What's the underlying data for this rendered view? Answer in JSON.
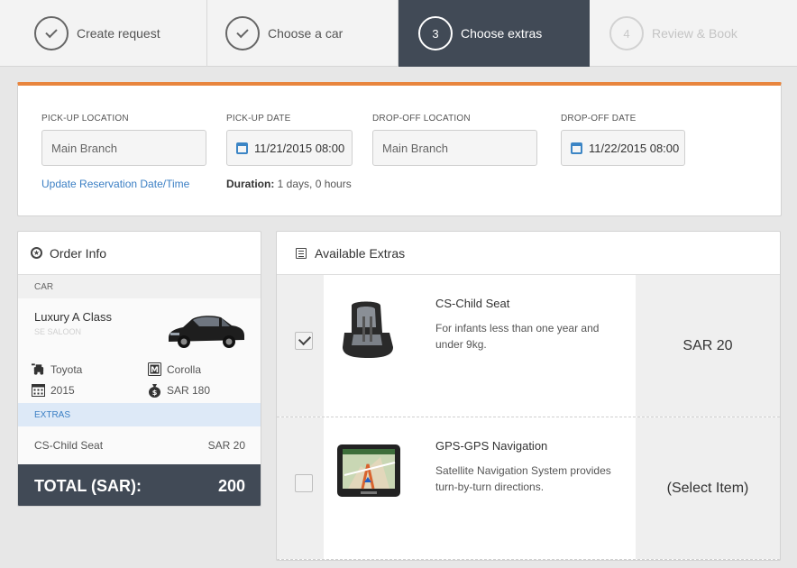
{
  "stepper": {
    "steps": [
      {
        "label": "Create request",
        "number": "",
        "state": "done"
      },
      {
        "label": "Choose a car",
        "number": "",
        "state": "done"
      },
      {
        "label": "Choose extras",
        "number": "3",
        "state": "active"
      },
      {
        "label": "Review & Book",
        "number": "4",
        "state": "pending"
      }
    ]
  },
  "reservation": {
    "pickup_location_label": "PICK-UP LOCATION",
    "pickup_location_value": "Main Branch",
    "pickup_date_label": "PICK-UP DATE",
    "pickup_date_value": "11/21/2015 08:00",
    "dropoff_location_label": "DROP-OFF LOCATION",
    "dropoff_location_value": "Main Branch",
    "dropoff_date_label": "DROP-OFF DATE",
    "dropoff_date_value": "11/22/2015 08:00",
    "update_link": "Update Reservation Date/Time",
    "duration_label": "Duration:",
    "duration_value": "1 days, 0 hours"
  },
  "order": {
    "title": "Order Info",
    "car_section": "CAR",
    "car_name": "Luxury A Class",
    "car_class": "SE SALOON",
    "make": "Toyota",
    "model": "Corolla",
    "year": "2015",
    "price": "SAR 180",
    "extras_section": "EXTRAS",
    "extras": [
      {
        "name": "CS-Child Seat",
        "price": "SAR 20"
      }
    ],
    "total_label": "TOTAL (SAR):",
    "total_value": "200"
  },
  "extras_panel": {
    "title": "Available Extras",
    "items": [
      {
        "title": "CS-Child Seat",
        "desc": "For infants less than one year and under 9kg.",
        "price": "SAR 20",
        "checked": true
      },
      {
        "title": "GPS-GPS Navigation",
        "desc": "Satellite Navigation System provides turn-by-turn directions.",
        "price": "(Select Item)",
        "checked": false
      }
    ]
  },
  "colors": {
    "accent_orange": "#e8853e",
    "dark_slate": "#414a56",
    "link_blue": "#3b7fc4"
  }
}
